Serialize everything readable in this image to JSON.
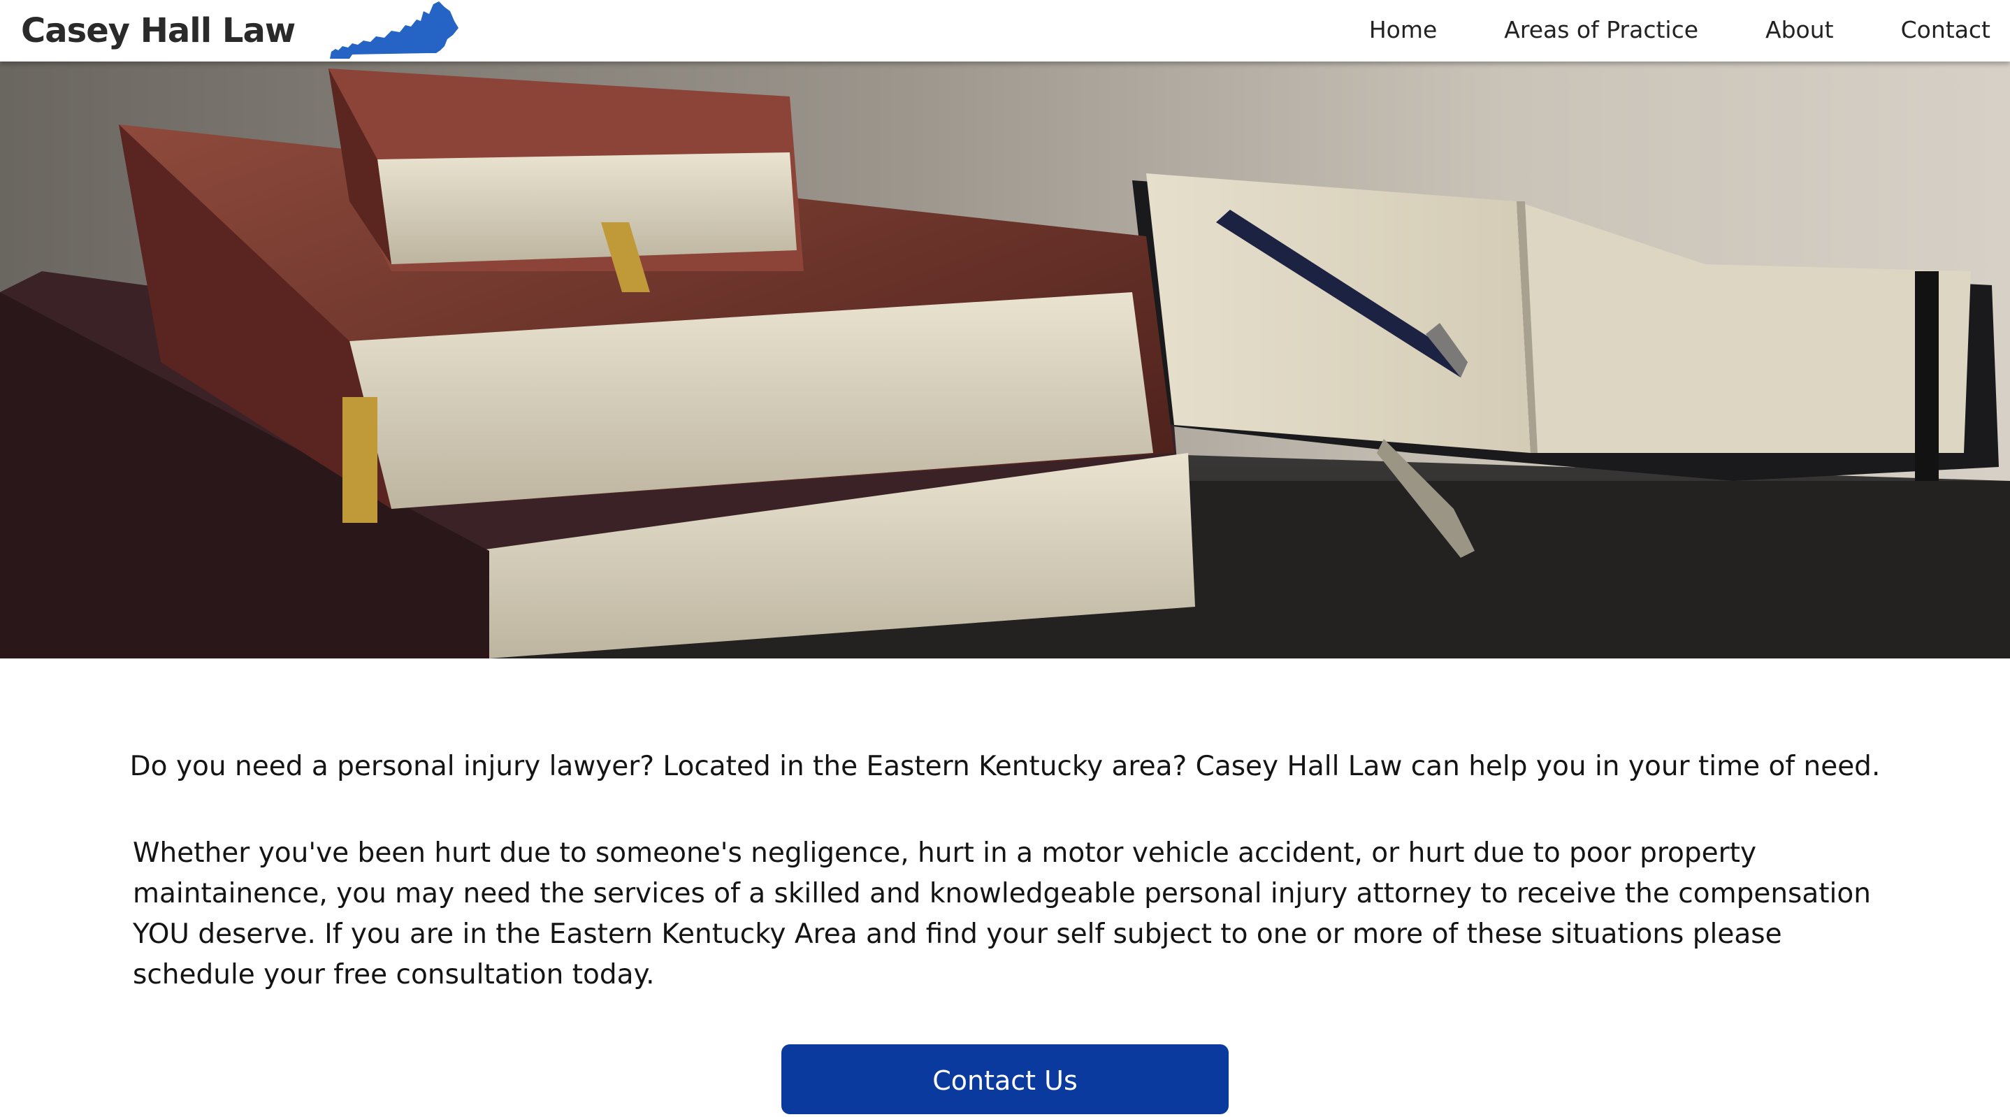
{
  "brand": {
    "name": "Casey Hall Law",
    "logo_icon": "kentucky-state-icon",
    "logo_color": "#2563c4"
  },
  "nav": {
    "items": [
      {
        "label": "Home"
      },
      {
        "label": "Areas of Practice"
      },
      {
        "label": "About"
      },
      {
        "label": "Contact"
      }
    ]
  },
  "hero": {
    "image": "law-books-and-pen-photo"
  },
  "main": {
    "lead": "Do you need a personal injury lawyer? Located in the Eastern Kentucky area? Casey Hall Law can help you in your time of need.",
    "body": "Whether you've been hurt due to someone's negligence, hurt in a motor vehicle accident, or hurt due to poor property maintainence, you may need the services of a skilled and knowledgeable personal injury attorney to receive the compensation YOU deserve. If you are in the Eastern Kentucky Area and find your self subject to one or more of these situations please schedule your free consultation today.",
    "cta_label": "Contact Us",
    "cta_color": "#0a3a9e"
  }
}
